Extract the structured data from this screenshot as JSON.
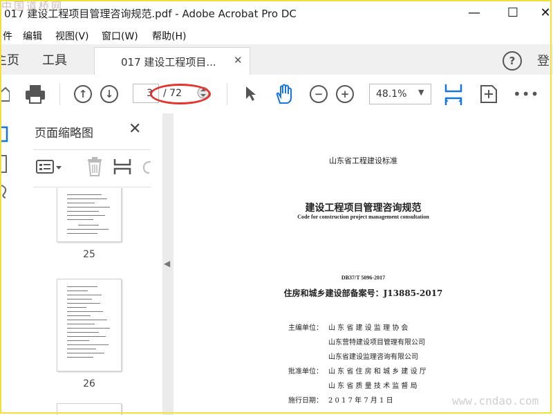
{
  "window": {
    "title": "017 建设工程项目管理咨询规范.pdf - Adobe Acrobat Pro DC",
    "watermark_top": "中国道桥网"
  },
  "menu": [
    "件",
    "编辑",
    "视图(V)",
    "窗口(W)",
    "帮助(H)"
  ],
  "tabs": {
    "home": "主页",
    "tools": "工具",
    "document": "017 建设工程项目...",
    "login": "登"
  },
  "toolbar": {
    "current_page": "3",
    "page_total": "/ 72",
    "zoom": "48.1%"
  },
  "thumbnail_panel": {
    "title": "页面缩略图",
    "pages": [
      "25",
      "26"
    ]
  },
  "document": {
    "standard_header": "山东省工程建设标准",
    "title_cn": "建设工程项目管理咨询规范",
    "title_en": "Code for construction project management consultation",
    "code": "DB37/T 5096-2017",
    "record_no": "住房和城乡建设部备案号：J13885-2017",
    "rows": [
      {
        "label": "主编单位：",
        "value": "山 东 省 建 设 监 理 协 会"
      },
      {
        "label": "",
        "value": "山东营特建设项目管理有限公司"
      },
      {
        "label": "",
        "value": "山东省建设监理咨询有限公司"
      },
      {
        "label": "批准单位：",
        "value": "山 东 省 住 房 和 城 乡 建 设 厅"
      },
      {
        "label": "",
        "value": "山 东 省 质 量 技 术 监 督 局"
      },
      {
        "label": "施行日期：",
        "value": "2   0   1   7     年     7     月     1     日"
      }
    ]
  },
  "watermark_bottom": "www.cndao.com",
  "colors": {
    "highlight_oval": "#e5322d",
    "frame": "#f1e23b",
    "icon_blue": "#1473e6"
  }
}
